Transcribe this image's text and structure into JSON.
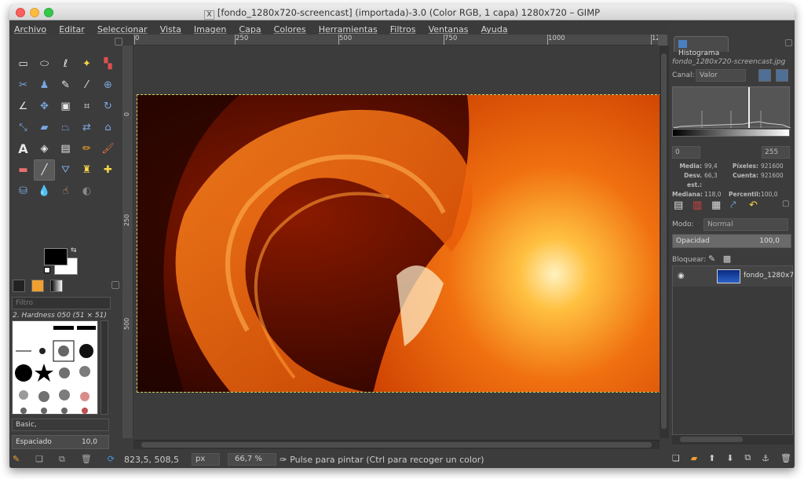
{
  "window": {
    "title": "[fondo_1280x720-screencast] (importada)-3.0 (Color RGB, 1 capa) 1280x720 – GIMP",
    "x_badge": "X"
  },
  "menu": [
    "Archivo",
    "Editar",
    "Seleccionar",
    "Vista",
    "Imagen",
    "Capa",
    "Colores",
    "Herramientas",
    "Filtros",
    "Ventanas",
    "Ayuda"
  ],
  "tools": [
    "rect-select-icon",
    "ellipse-select-icon",
    "lasso-icon",
    "fuzzy-select-icon",
    "color-select-icon",
    "scissors-icon",
    "foreground-select-icon",
    "paths-icon",
    "color-picker-icon",
    "zoom-icon",
    "measure-icon",
    "move-icon",
    "align-icon",
    "crop-icon",
    "rotate-icon",
    "scale-icon",
    "shear-icon",
    "perspective-icon",
    "flip-icon",
    "cage-icon",
    "text-icon",
    "bucket-fill-icon",
    "blend-icon",
    "pencil-icon",
    "paintbrush-icon",
    "eraser-icon",
    "airbrush-icon",
    "ink-icon",
    "clone-icon",
    "heal-icon",
    "perspective-clone-icon",
    "blur-icon",
    "smudge-icon",
    "dodge-burn-icon"
  ],
  "brushes": {
    "preset_filter": "Filtro",
    "current_brush": "2. Hardness 050 (51 × 51)",
    "tag": "Basic,",
    "spacing_label": "Espaciado",
    "spacing_value": "10,0"
  },
  "ruler": {
    "top_labels": [
      "0",
      "250",
      "500",
      "750",
      "1000",
      "12"
    ],
    "left_labels": [
      "0",
      "250",
      "500"
    ]
  },
  "status": {
    "coords": "823,5, 508,5",
    "unit": "px",
    "zoom": "66,7 %",
    "message": "Pulse para pintar (Ctrl para recoger un color)"
  },
  "histogram": {
    "tab_label": "Histograma",
    "file": "fondo_1280x720-screencast.jpg",
    "channel_label": "Canal:",
    "channel_value": "Valor",
    "range_min": "0",
    "range_max": "255",
    "stats": [
      {
        "k": "Media:",
        "v": "99,4",
        "k2": "Píxeles:",
        "v2": "921600"
      },
      {
        "k": "Desv. est.:",
        "v": "66,3",
        "k2": "Cuenta:",
        "v2": "921600"
      },
      {
        "k": "Mediana:",
        "v": "118,0",
        "k2": "Percentil:",
        "v2": "100,0"
      }
    ]
  },
  "layers": {
    "mode_label": "Modo:",
    "mode_value": "Normal",
    "opacity_label": "Opacidad",
    "opacity_value": "100,0",
    "lock_label": "Bloquear:",
    "layer_name": "fondo_1280x7"
  },
  "colors": {
    "accent": "#4a80c0",
    "selection": "#d4cf59"
  }
}
